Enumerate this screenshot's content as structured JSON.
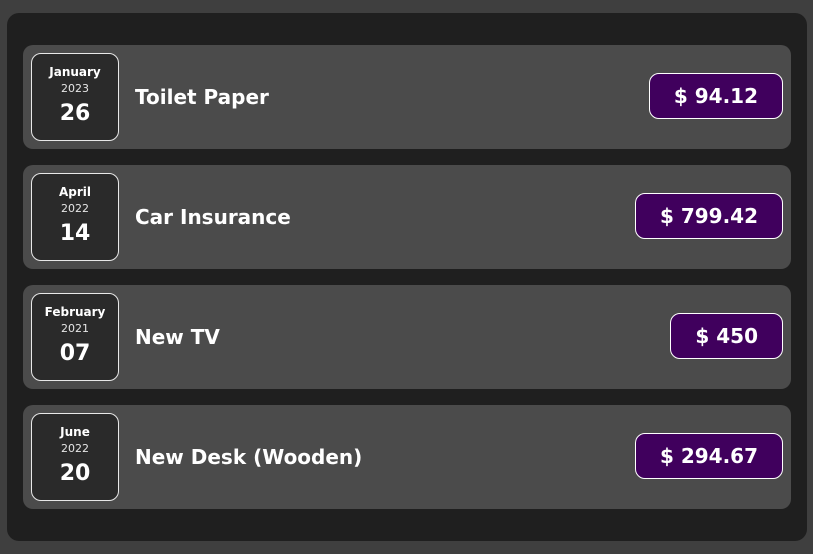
{
  "expenses": [
    {
      "date": {
        "month": "January",
        "year": "2023",
        "day": "26"
      },
      "title": "Toilet Paper",
      "amount": "$ 94.12"
    },
    {
      "date": {
        "month": "April",
        "year": "2022",
        "day": "14"
      },
      "title": "Car Insurance",
      "amount": "$ 799.42"
    },
    {
      "date": {
        "month": "February",
        "year": "2021",
        "day": "07"
      },
      "title": "New TV",
      "amount": "$ 450"
    },
    {
      "date": {
        "month": "June",
        "year": "2022",
        "day": "20"
      },
      "title": "New Desk (Wooden)",
      "amount": "$ 294.67"
    }
  ],
  "colors": {
    "page_background": "#3f3f3f",
    "panel_background": "#1f1f1f",
    "item_background": "#4b4b4b",
    "date_background": "#2a2a2a",
    "price_background": "#40005d",
    "text": "#ffffff"
  }
}
